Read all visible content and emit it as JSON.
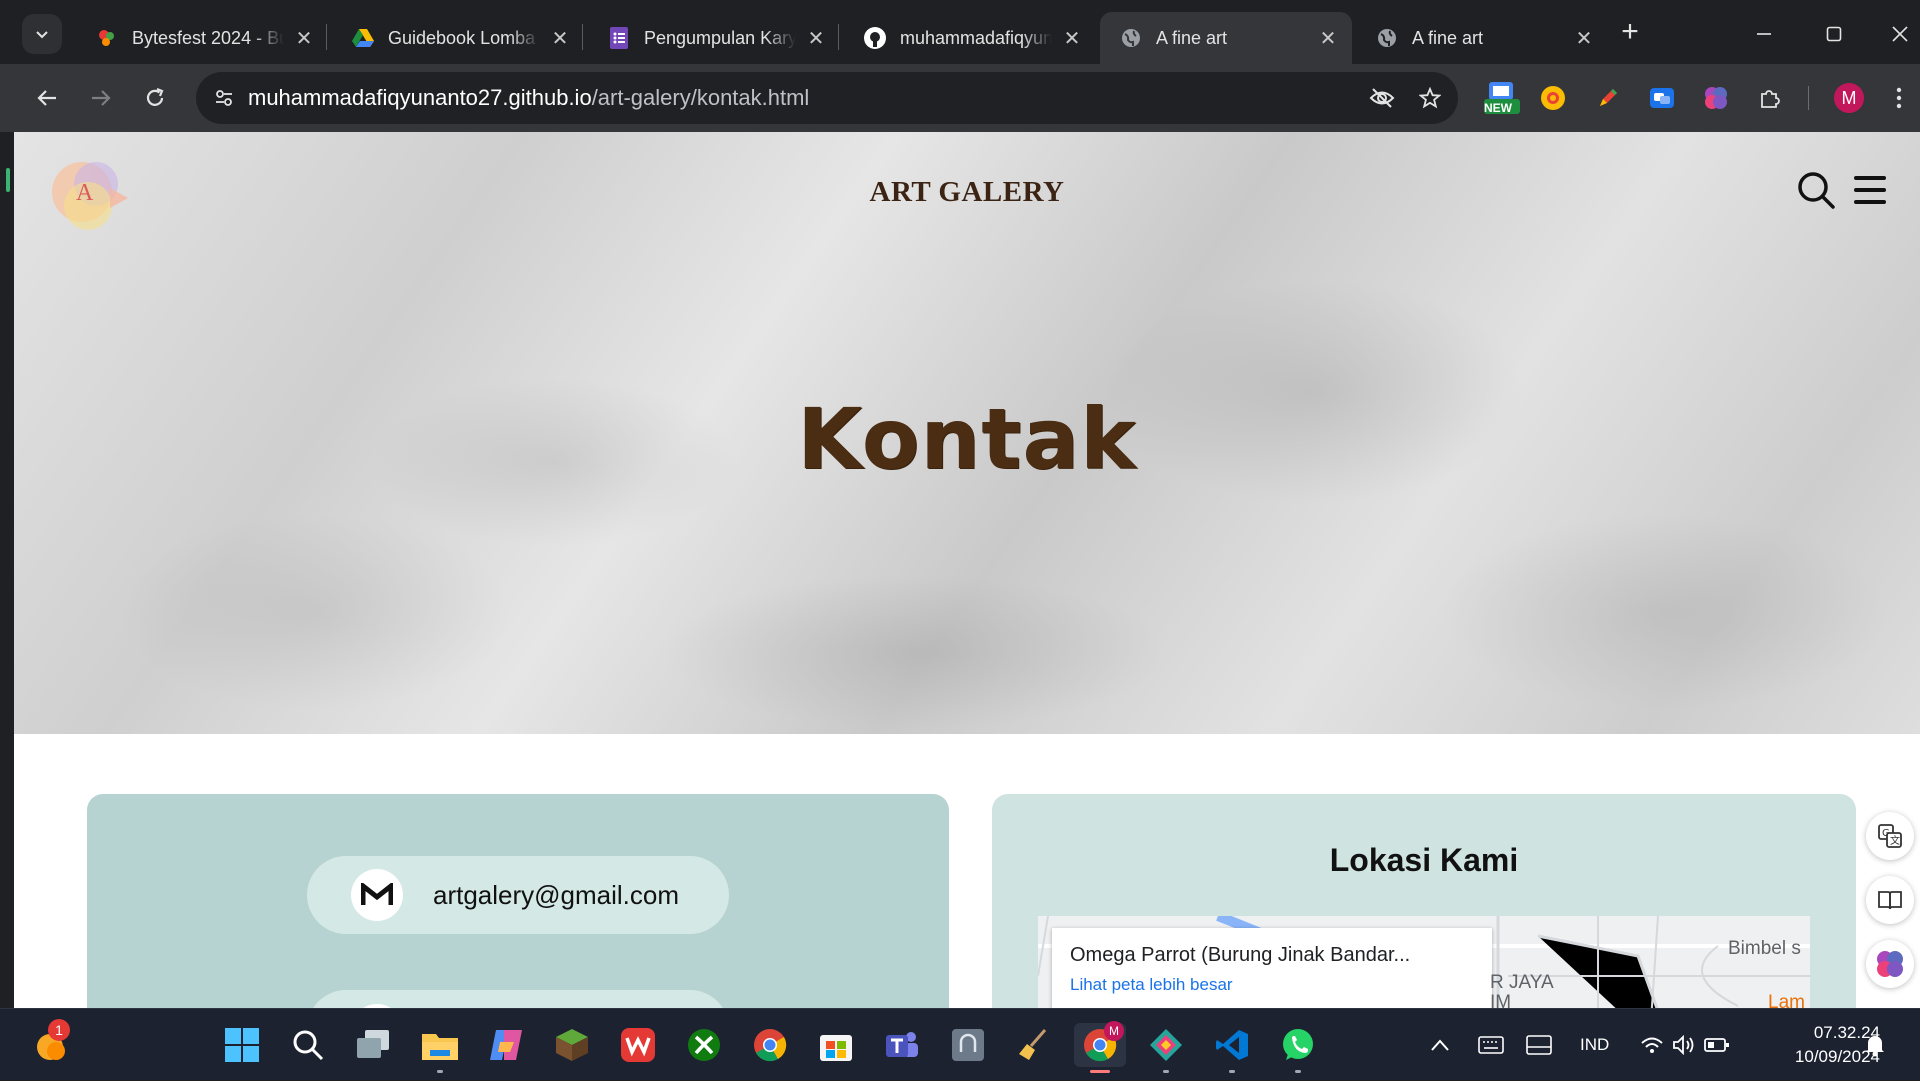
{
  "browser": {
    "tabs": [
      {
        "title": "Bytesfest 2024 - Bu",
        "favicon": "bytesfest-icon",
        "active": false
      },
      {
        "title": "Guidebook Lomba",
        "favicon": "google-drive-icon",
        "active": false
      },
      {
        "title": "Pengumpulan Kary",
        "favicon": "google-forms-icon",
        "active": false
      },
      {
        "title": "muhammadafiqyun",
        "favicon": "github-icon",
        "active": false
      },
      {
        "title": "A fine art",
        "favicon": "globe-icon",
        "active": true
      },
      {
        "title": "A fine art",
        "favicon": "globe-icon",
        "active": false
      }
    ],
    "url_host": "muhammadafiqyunanto27.github.io",
    "url_path": "/art-galery/kontak.html",
    "profile_initial": "M",
    "extension_new_badge": "NEW"
  },
  "page": {
    "brand": "ART GALERY",
    "logo_letter": "A",
    "hero_title": "Kontak",
    "contact": {
      "email": "artgalery@gmail.com"
    },
    "location": {
      "title": "Lokasi Kami",
      "map_place": "Omega Parrot (Burung Jinak Bandar...",
      "map_link": "Lihat peta lebih besar",
      "map_label_1": "Bimbel s",
      "map_label_2": "R JAYA",
      "map_label_3": "IM",
      "map_label_4": "Lam"
    }
  },
  "taskbar": {
    "notification_count": "1",
    "language": "IND",
    "time": "07.32.24",
    "date": "10/09/2024"
  },
  "colors": {
    "hero_title": "#4a2d12",
    "contact_card": "#b7d3d1",
    "location_card": "#cfe3e0",
    "link": "#1a73e8"
  }
}
